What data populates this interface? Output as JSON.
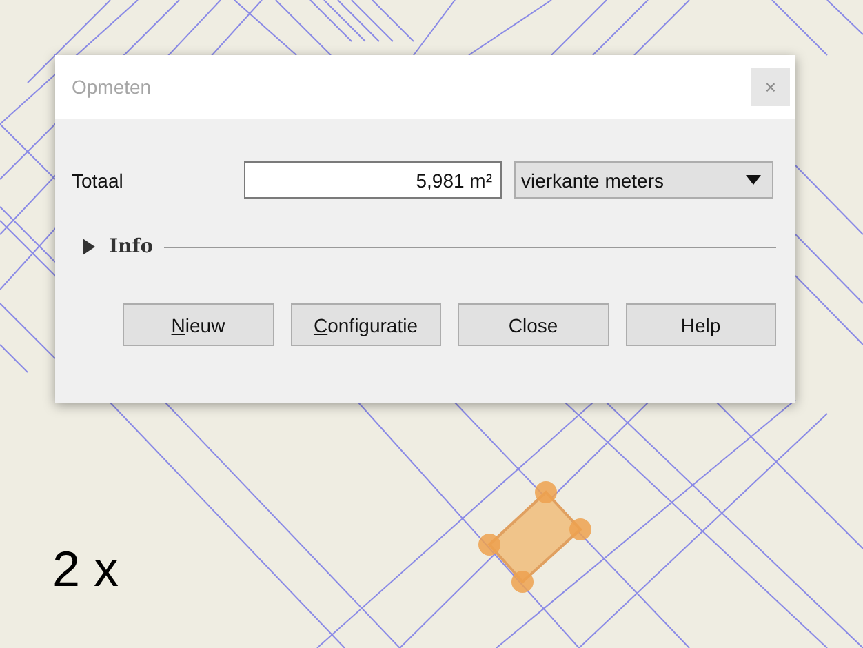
{
  "dialog": {
    "title": "Opmeten",
    "close_glyph": "×"
  },
  "total": {
    "label": "Totaal",
    "value": "5,981 m²",
    "unit": "vierkante meters"
  },
  "info": {
    "label": "Info",
    "expanded": false
  },
  "buttons": [
    {
      "label": "Nieuw",
      "underline_first": true
    },
    {
      "label": "Configuratie",
      "underline_first": true
    },
    {
      "label": "Close",
      "underline_first": false
    },
    {
      "label": "Help",
      "underline_first": false
    }
  ],
  "overlay_label": "2 x"
}
